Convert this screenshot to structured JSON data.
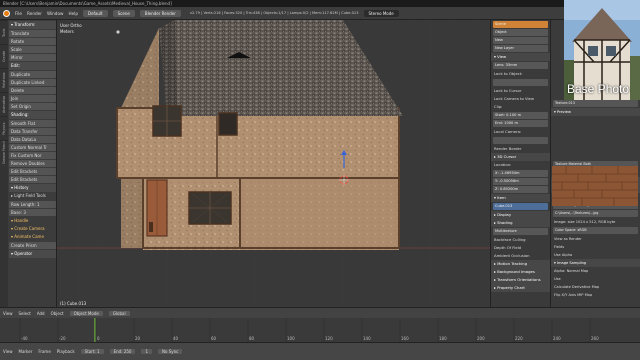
{
  "window": {
    "title": "Blender [C:\\Users\\Benjamin\\Documents\\Game_Assets\\Medieval_House_Thing.blend]"
  },
  "menubar": {
    "items": [
      "File",
      "Render",
      "Window",
      "Help"
    ],
    "layout": "Default",
    "scene": "Scene",
    "engine": "Blender Render",
    "stats": "v2.79 | Verts:216 | Faces:320 | Tris:438 | Objects:1/17 | Lamps:0/2 | Mem:117.62M | Cube.013",
    "mode_field": "Stereo Mode"
  },
  "toolshelf": {
    "tabs": [
      "Tools",
      "Create",
      "Relations",
      "Animation",
      "Physics",
      "Grease Pencil"
    ],
    "rows": [
      {
        "label": "▾ Transform:",
        "type": "head"
      },
      {
        "label": "Translate",
        "type": "btn"
      },
      {
        "label": "Rotate",
        "type": "btn"
      },
      {
        "label": "Scale",
        "type": "btn"
      },
      {
        "label": "Mirror",
        "type": "btn"
      },
      {
        "label": "Edit:",
        "type": "head"
      },
      {
        "label": "Duplicate",
        "type": "btn"
      },
      {
        "label": "Duplicate Linked",
        "type": "btn"
      },
      {
        "label": "Delete",
        "type": "btn"
      },
      {
        "label": "Join",
        "type": "btn"
      },
      {
        "label": "Set Origin",
        "type": "btn"
      },
      {
        "label": "Shading:",
        "type": "head"
      },
      {
        "label": "Smooth  Flat",
        "type": "btn"
      },
      {
        "label": "Data Transfer",
        "type": "btn"
      },
      {
        "label": "Data      DataLa",
        "type": "btn"
      },
      {
        "label": "Custom Normal Tr",
        "type": "btn"
      },
      {
        "label": "Fix Custom Nor",
        "type": "btn"
      },
      {
        "label": "Remove Doubles",
        "type": "btn"
      },
      {
        "label": "Edit Brackets",
        "type": "btn"
      },
      {
        "label": "Edit Brackets",
        "type": "btn"
      },
      {
        "label": "▾ History",
        "type": "head"
      },
      {
        "label": "▸ Light Field Tools",
        "type": "row"
      },
      {
        "label": "Row Length: 1",
        "type": "btn"
      },
      {
        "label": "Base:    3",
        "type": "btn"
      },
      {
        "label": "▾ Handle",
        "type": "sel"
      },
      {
        "label": "▾ Create Camera",
        "type": "sel"
      },
      {
        "label": "▾ Animate Came",
        "type": "sel"
      },
      {
        "label": "Create Prism",
        "type": "btn"
      },
      {
        "label": "▾ Operator",
        "type": "head"
      }
    ]
  },
  "viewport": {
    "view_label": "User Ortho",
    "units_label": "Meters",
    "object_label": "(1) Cube.013"
  },
  "view_panel": {
    "rows": [
      {
        "label": "Scene",
        "type": "field-orange"
      },
      {
        "label": "Object",
        "type": "field"
      },
      {
        "label": "New",
        "type": "field"
      },
      {
        "label": "New Layer",
        "type": "field"
      },
      {
        "label": "▾ View",
        "type": "head"
      },
      {
        "label": "Lens: 35mm",
        "type": "field"
      },
      {
        "label": "Lock to Object:",
        "type": "row"
      },
      {
        "label": "",
        "type": "field"
      },
      {
        "label": "Lock to Cursor",
        "type": "row"
      },
      {
        "label": "Lock Camera to View",
        "type": "row"
      },
      {
        "label": "Clip:",
        "type": "row"
      },
      {
        "label": "Start:  0.100 m",
        "type": "field"
      },
      {
        "label": "End:    1000 m",
        "type": "field"
      },
      {
        "label": "Local Camera:",
        "type": "row"
      },
      {
        "label": "",
        "type": "field"
      },
      {
        "label": "Render Border",
        "type": "row"
      },
      {
        "label": "▸ 3D Cursor",
        "type": "head"
      },
      {
        "label": "Location:",
        "type": "row"
      },
      {
        "label": "X:   -1.46934m",
        "type": "field"
      },
      {
        "label": "Y:   -0.50056m",
        "type": "field"
      },
      {
        "label": "Z:    0.89200m",
        "type": "field"
      },
      {
        "label": "▾ Item",
        "type": "head"
      },
      {
        "label": "Cube.013",
        "type": "field-blue"
      },
      {
        "label": "▸ Display",
        "type": "head"
      },
      {
        "label": "▸ Shading",
        "type": "head"
      },
      {
        "label": "Multitexture",
        "type": "field"
      },
      {
        "label": "Backface Culling",
        "type": "row"
      },
      {
        "label": "Depth Of Field",
        "type": "row"
      },
      {
        "label": "Ambient Occlusion",
        "type": "row"
      },
      {
        "label": "▸ Motion Tracking",
        "type": "head"
      },
      {
        "label": "▸ Background Images",
        "type": "head"
      },
      {
        "label": "▸ Transform Orientations",
        "type": "head"
      },
      {
        "label": "▸ Property Chart",
        "type": "head"
      }
    ]
  },
  "properties": {
    "rows": [
      {
        "label": "Texture.013",
        "type": "field"
      },
      {
        "label": "▾ Preview",
        "type": "head"
      },
      {
        "label": "",
        "type": "spacer"
      },
      {
        "label": "Texture  Material  Both",
        "type": "field"
      },
      {
        "label": "Show Alpha",
        "type": "row"
      },
      {
        "label": "▸ Colors",
        "type": "head"
      },
      {
        "label": "▾ Image",
        "type": "head"
      },
      {
        "label": "WoodenShinglesM_Sh",
        "type": "field"
      },
      {
        "label": "Source:   Single Image",
        "type": "field"
      },
      {
        "label": "C:\\Users\\...\\Textures\\...jpg",
        "type": "field"
      },
      {
        "label": "Image: size 1024 x 512, RGB byte",
        "type": "row"
      },
      {
        "label": "Color Space:  sRGB",
        "type": "field"
      },
      {
        "label": "View as Render",
        "type": "row"
      },
      {
        "label": "Fields",
        "type": "row"
      },
      {
        "label": "Use Alpha",
        "type": "row"
      },
      {
        "label": "▾ Image Sampling",
        "type": "head"
      },
      {
        "label": "Alpha:       Normal Map",
        "type": "row"
      },
      {
        "label": "Use          ",
        "type": "row"
      },
      {
        "label": "Calculate    Derivative Map",
        "type": "row"
      },
      {
        "label": "Flip X/Y Axis   MIP Map",
        "type": "row"
      }
    ]
  },
  "base_photo": {
    "label": "Base Photo"
  },
  "viewport_header": {
    "items": [
      "View",
      "Select",
      "Add",
      "Object"
    ],
    "mode": "Object Mode",
    "pivot": "Global",
    "layer_hint": ""
  },
  "timeline": {
    "items": [
      "View",
      "Marker",
      "Frame",
      "Playback"
    ],
    "start": "Start: 1",
    "end": "End: 250",
    "current": "1",
    "sync": "No Sync",
    "ruler": [
      "-40",
      "-20",
      "0",
      "20",
      "40",
      "60",
      "80",
      "100",
      "120",
      "140",
      "160",
      "180",
      "200",
      "220",
      "240",
      "260"
    ]
  },
  "colors": {
    "accent_orange": "#d08336",
    "accent_blue": "#4e6e9a"
  }
}
